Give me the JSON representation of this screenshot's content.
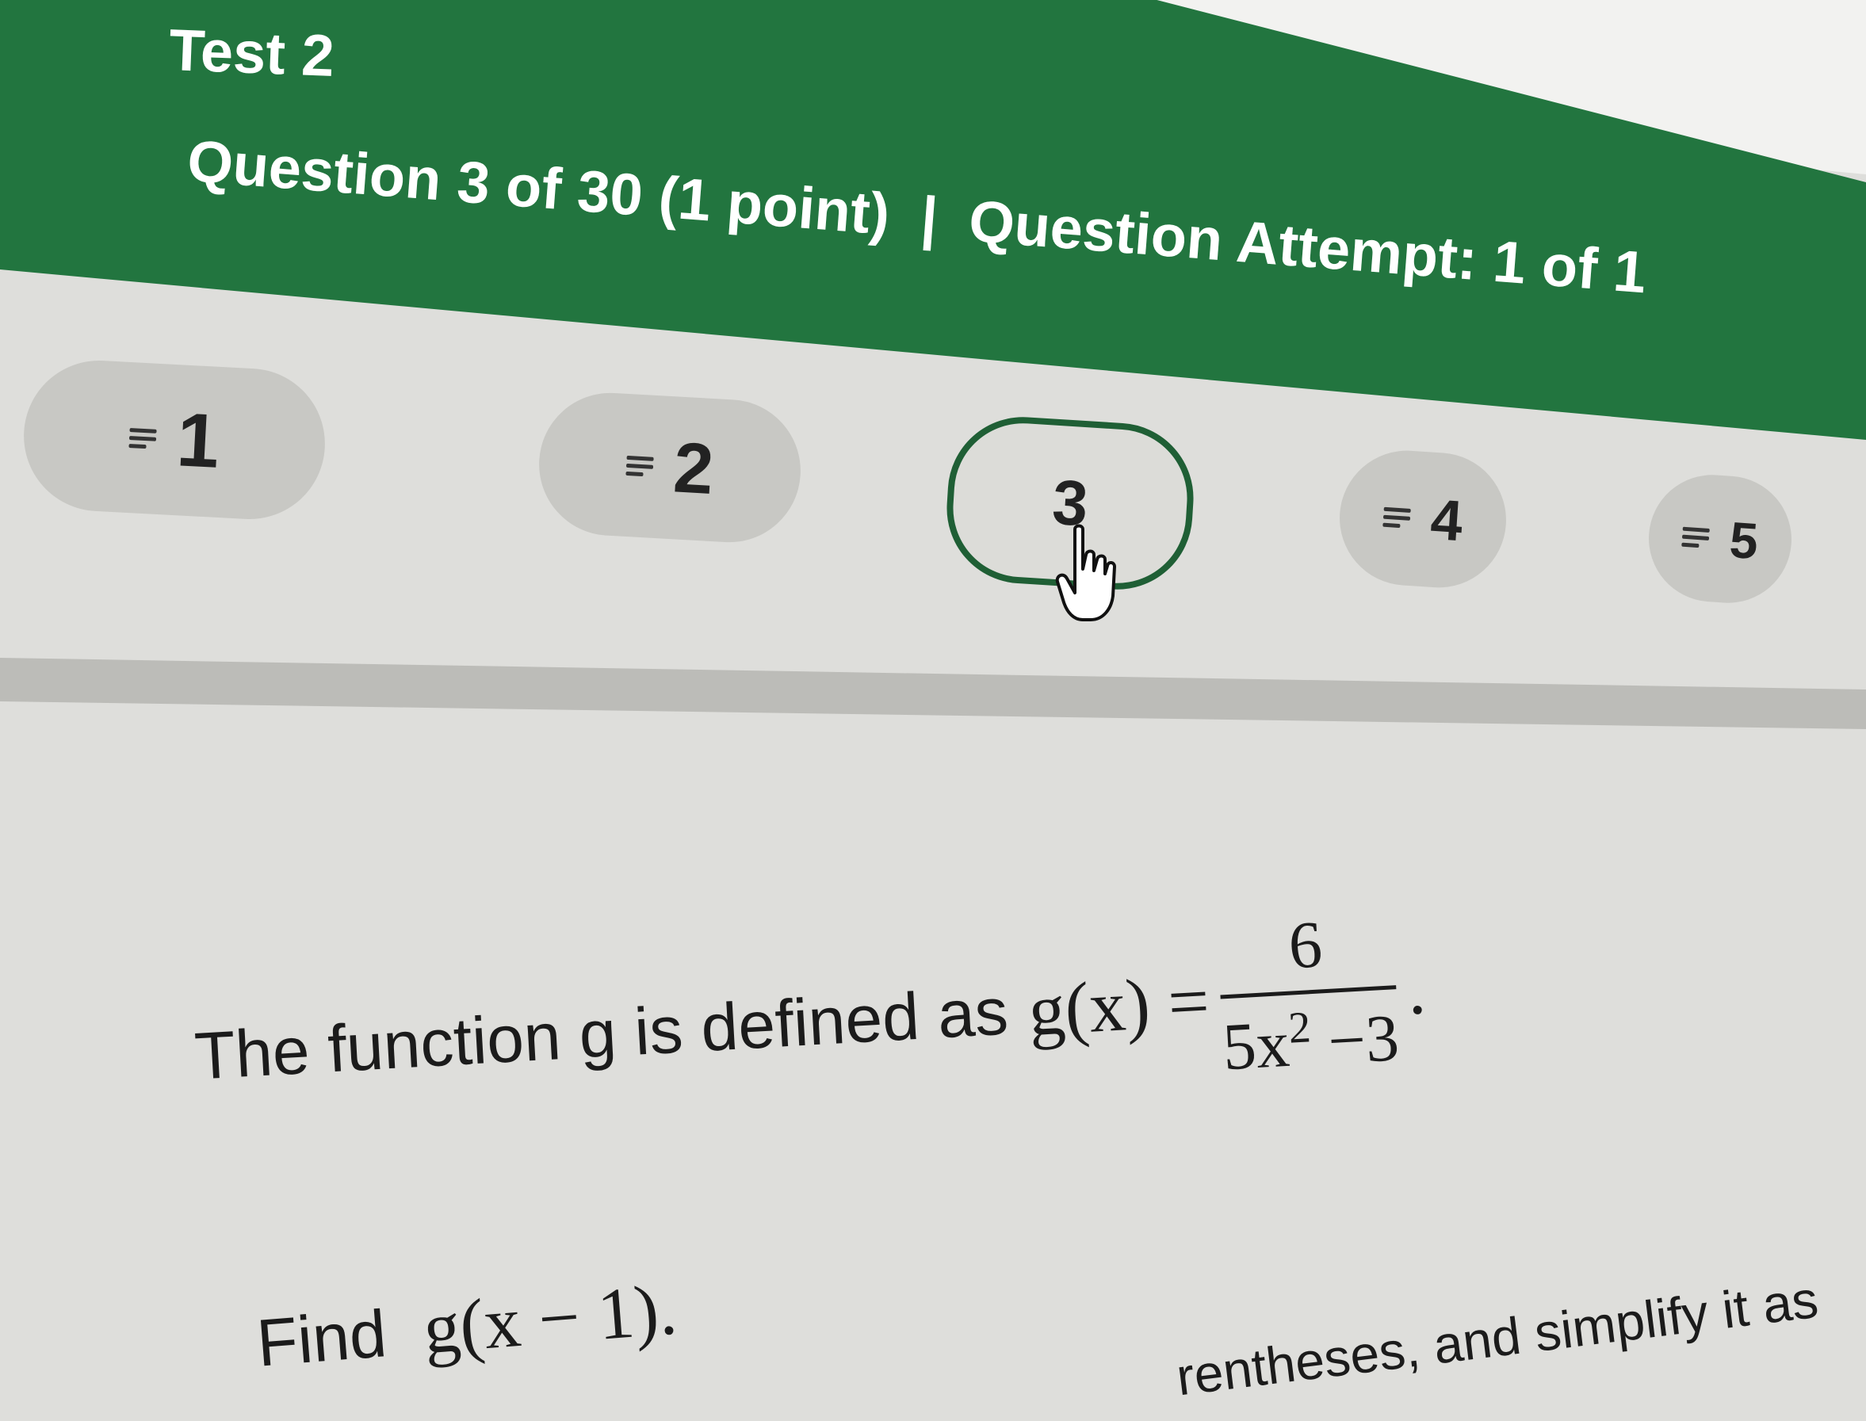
{
  "header": {
    "test_title": "Test 2",
    "question_progress": "Question 3 of 30 (1 point)",
    "separator": "|",
    "attempt": "Question Attempt: 1 of 1"
  },
  "nav": {
    "items": [
      {
        "label": "1",
        "state": "default"
      },
      {
        "label": "2",
        "state": "default"
      },
      {
        "label": "3",
        "state": "current"
      },
      {
        "label": "4",
        "state": "default"
      },
      {
        "label": "5",
        "state": "default"
      }
    ]
  },
  "question": {
    "prompt_text": "The function g is defined as",
    "function_lhs": "g(x) =",
    "fraction_numerator": "6",
    "fraction_denominator_base": "5x",
    "fraction_denominator_exponent": "2",
    "fraction_denominator_tail": " −3",
    "prompt_end": ".",
    "find_label": "Find",
    "find_expression": "g(x − 1).",
    "instruction_fragment": "rentheses, and simplify it as"
  },
  "colors": {
    "header_green": "#22753f",
    "current_pill_border": "#1f5f35",
    "pill_bg": "#c8c8c4"
  },
  "icons": {
    "nav_item_icon": "lines-icon",
    "cursor": "hand-pointer-icon"
  }
}
